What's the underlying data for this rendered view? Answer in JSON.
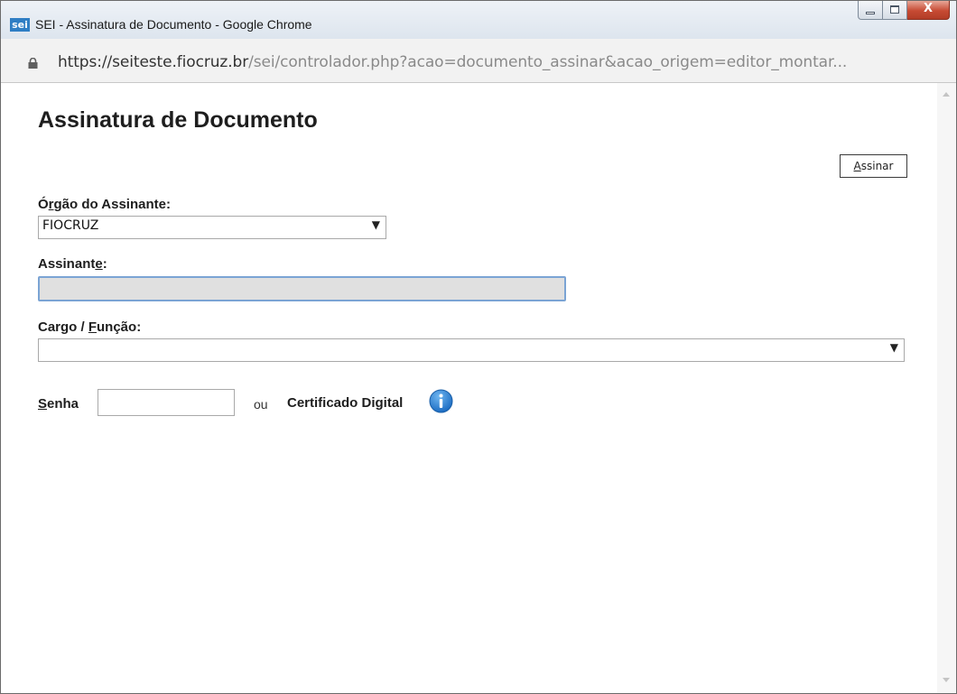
{
  "window": {
    "title": "SEI - Assinatura de Documento - Google Chrome",
    "logo_text": "sei",
    "close_glyph": "X"
  },
  "urlbar": {
    "host": "https://seiteste.fiocruz.br",
    "path": "/sei/controlador.php?acao=documento_assinar&acao_origem=editor_montar..."
  },
  "page": {
    "title": "Assinatura de Documento"
  },
  "form": {
    "assinar_button": {
      "first": "A",
      "rest": "ssinar"
    },
    "orgao": {
      "label_a": "Ó",
      "label_u": "r",
      "label_b": "gão do Assinante:",
      "selected": "FIOCRUZ"
    },
    "assinante": {
      "label_a": "Assinant",
      "label_u": "e",
      "label_b": ":",
      "value": ""
    },
    "cargo": {
      "label_a": "Cargo / ",
      "label_u": "F",
      "label_b": "unção:",
      "selected": ""
    },
    "senha": {
      "label_u": "S",
      "label_b": "enha",
      "value": ""
    },
    "ou": "ou",
    "certificado": "Certificado Digital"
  },
  "icons": {
    "lock": "lock-icon",
    "info": "info-icon",
    "dropdown": "chevron-down-icon"
  },
  "colors": {
    "sei_logo": "#2f7ec4",
    "info_icon": "#2a7fd4",
    "focus_border": "#7ba4d4",
    "disabled_bg": "#e0e0e0"
  }
}
